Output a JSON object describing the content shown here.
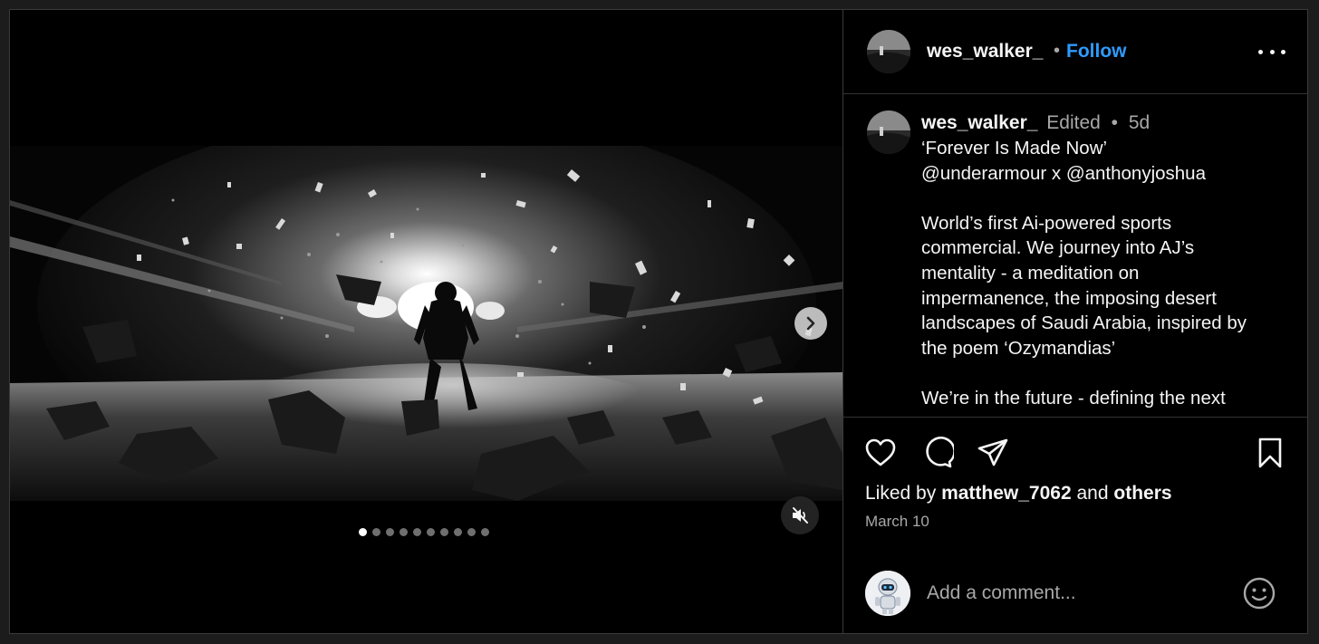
{
  "post": {
    "username": "wes_walker_",
    "follow_label": "Follow",
    "header_separator": "•",
    "more_icon": "more-horizontal-icon"
  },
  "caption": {
    "username": "wes_walker_",
    "edited": "Edited",
    "separator": "•",
    "time": "5d",
    "lines": [
      "‘Forever Is Made Now’",
      "@underarmour x @anthonyjoshua",
      "",
      "World’s first Ai-powered sports",
      "commercial. We journey into AJ’s",
      "mentality - a meditation on",
      "impermanence, the imposing desert",
      "landscapes of Saudi Arabia, inspired by",
      "the poem ‘Ozymandias’",
      "",
      "We’re in the future - defining the next"
    ]
  },
  "media": {
    "slide_count": 10,
    "active_slide": 1,
    "next_icon": "chevron-right-icon",
    "mute_icon": "speaker-muted-icon"
  },
  "actions": {
    "icons": [
      "heart-icon",
      "comment-icon",
      "share-icon",
      "bookmark-icon"
    ],
    "liked_prefix": "Liked by",
    "liked_user": "matthew_7062",
    "liked_and": "and",
    "liked_others": "others",
    "date": "March 10"
  },
  "comment": {
    "placeholder": "Add a comment...",
    "emoji_icon": "emoji-smile-icon"
  },
  "colors": {
    "background": "#000000",
    "follow_blue": "#2f9bff",
    "muted_text": "#a8a8a8"
  }
}
